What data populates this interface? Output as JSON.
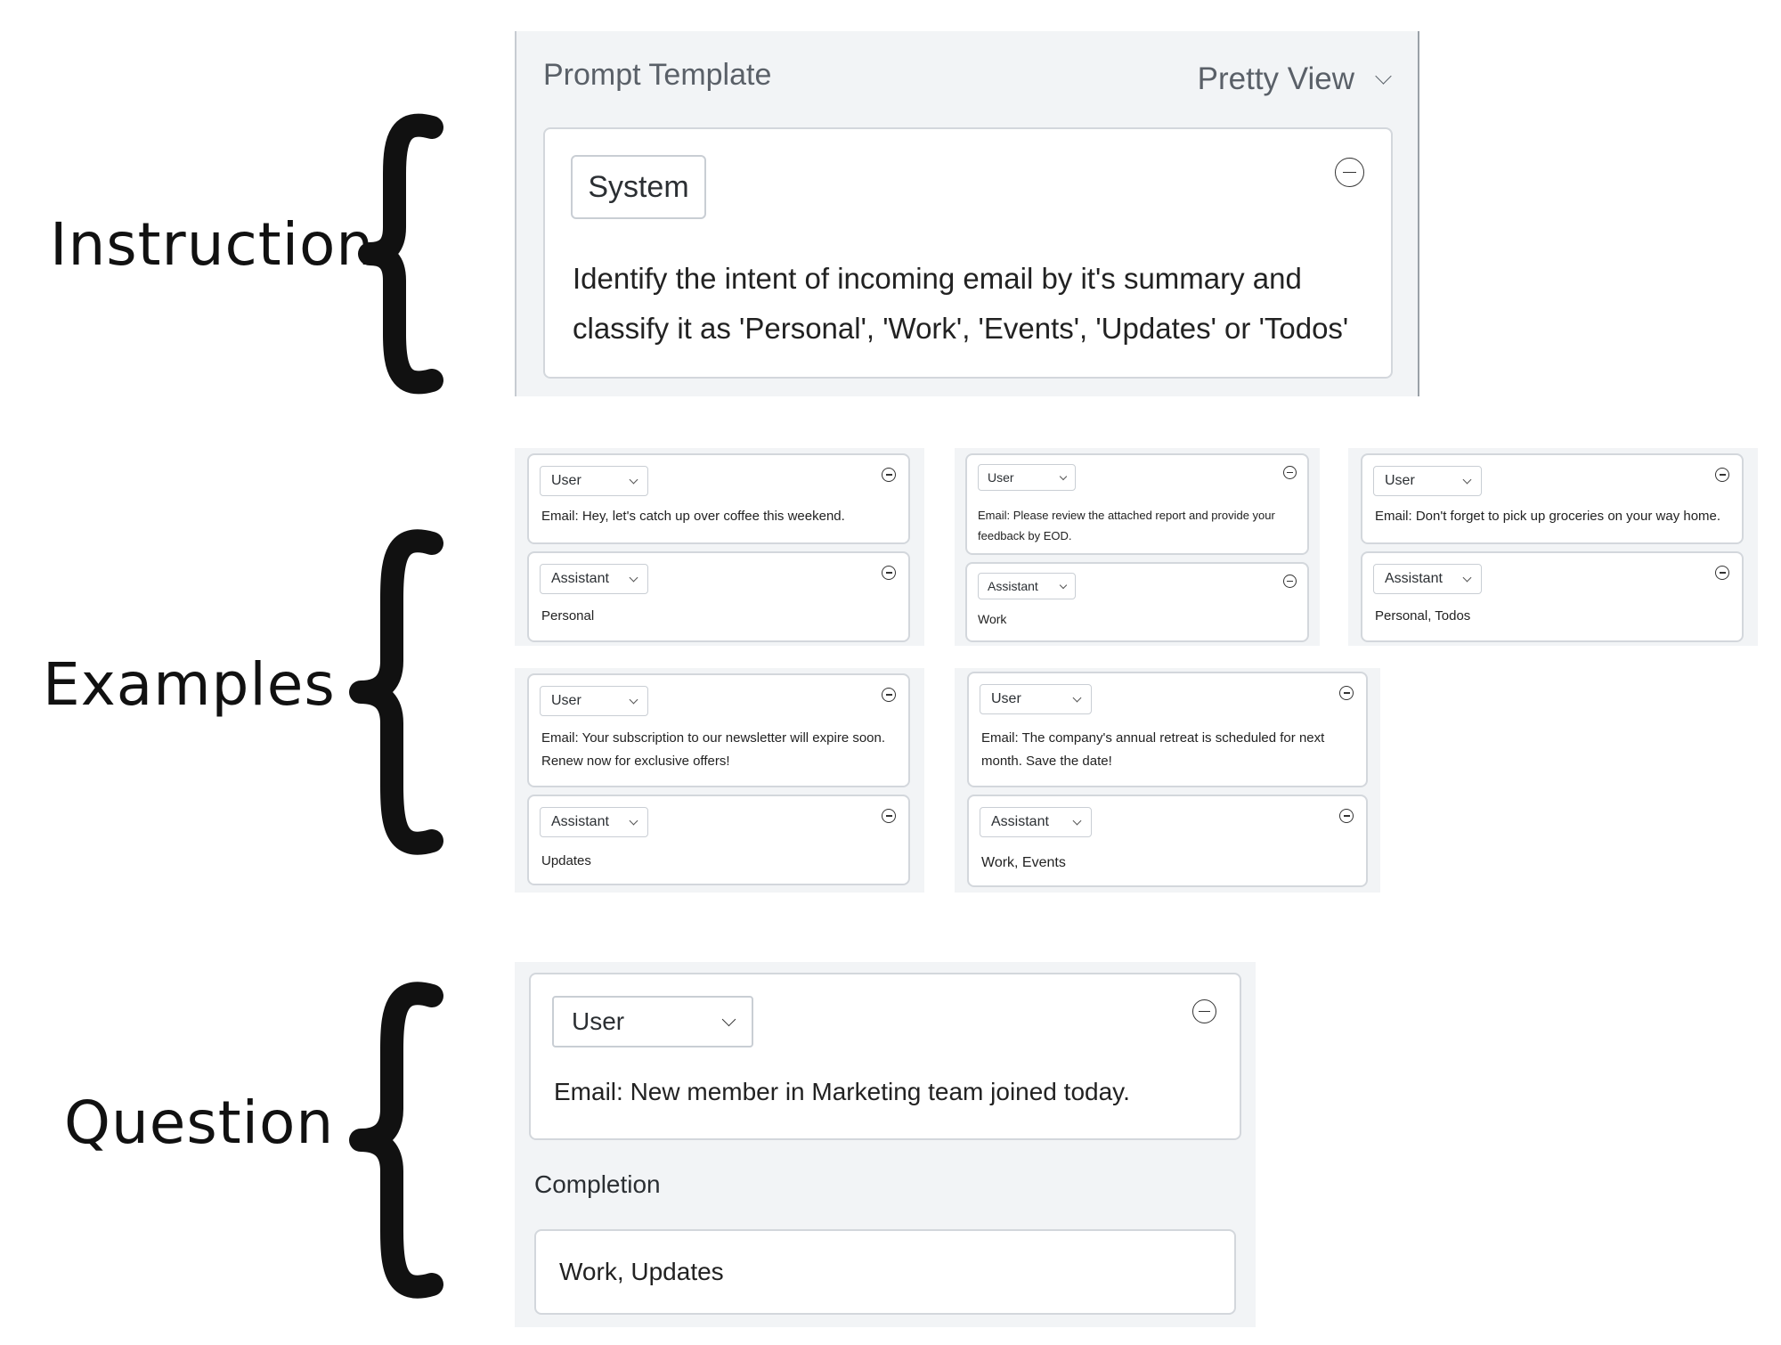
{
  "labels": {
    "instruction": "Instruction",
    "examples": "Examples",
    "question": "Question"
  },
  "template": {
    "title": "Prompt Template",
    "view_select": "Pretty View",
    "system_role": "System",
    "system_text_line1": "Identify the intent of incoming email by it's summary and",
    "system_text_line2": "classify it as 'Personal', 'Work', 'Events', 'Updates' or 'Todos'"
  },
  "examples": [
    {
      "user_role": "User",
      "user_text": "Email: Hey, let's catch up over coffee this weekend.",
      "assistant_role": "Assistant",
      "assistant_text": "Personal"
    },
    {
      "user_role": "User",
      "user_text_line1": "Email: Please review the attached report and provide your",
      "user_text_line2": "feedback by EOD.",
      "assistant_role": "Assistant",
      "assistant_text": "Work"
    },
    {
      "user_role": "User",
      "user_text": "Email: Don't forget to pick up groceries on your way home.",
      "assistant_role": "Assistant",
      "assistant_text": "Personal, Todos"
    },
    {
      "user_role": "User",
      "user_text_line1": "Email: Your subscription to our newsletter will expire soon.",
      "user_text_line2": "Renew now for exclusive offers!",
      "assistant_role": "Assistant",
      "assistant_text": "Updates"
    },
    {
      "user_role": "User",
      "user_text_line1": "Email: The company's annual retreat is scheduled for next",
      "user_text_line2": "month. Save the date!",
      "assistant_role": "Assistant",
      "assistant_text": "Work, Events"
    }
  ],
  "question": {
    "user_role": "User",
    "user_text": "Email: New member in Marketing team joined today.",
    "completion_label": "Completion",
    "completion_value": "Work, Updates"
  }
}
